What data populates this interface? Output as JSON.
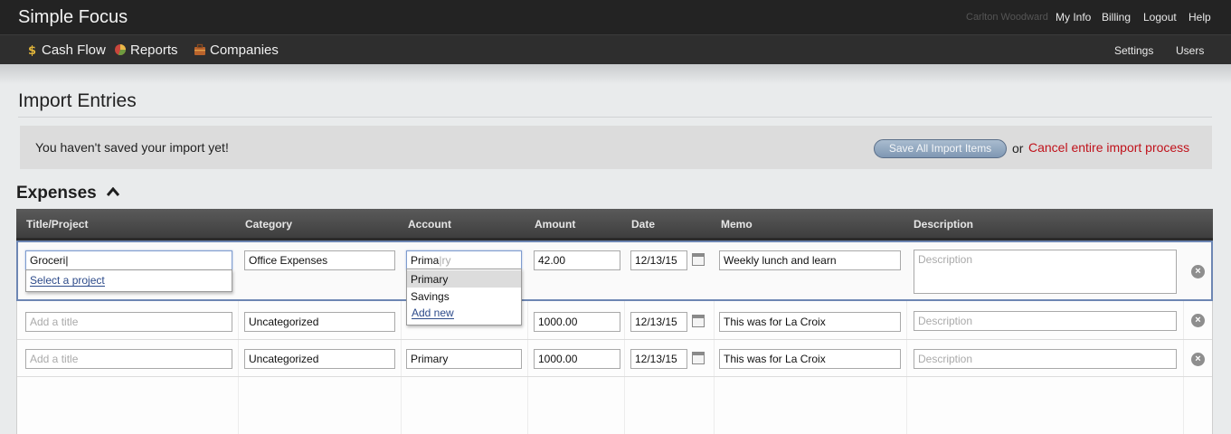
{
  "header": {
    "app_title": "Simple Focus",
    "user_name": "Carlton Woodward",
    "links": [
      "My Info",
      "Billing",
      "Logout",
      "Help"
    ]
  },
  "nav": {
    "items": [
      "Cash Flow",
      "Reports",
      "Companies"
    ],
    "right_links": [
      "Settings",
      "Users"
    ]
  },
  "page": {
    "title": "Import Entries"
  },
  "notice": {
    "message": "You haven't saved your import yet!",
    "save_label": "Save All Import Items",
    "or_text": "or",
    "cancel_label": "Cancel entire import process"
  },
  "section": {
    "title": "Expenses",
    "caret": "⌃"
  },
  "table": {
    "columns": [
      "Title/Project",
      "Category",
      "Account",
      "Amount",
      "Date",
      "Memo",
      "Description"
    ],
    "rows": [
      {
        "title": "Groceri|",
        "category": "Office Expenses",
        "account_typed": "Prima",
        "account_hint": "|ry",
        "amount": "42.00",
        "date": "12/13/15",
        "memo": "Weekly lunch and learn",
        "description_placeholder": "Description"
      },
      {
        "title_placeholder": "Add a title",
        "category": "Uncategorized",
        "account": "Primary",
        "amount": "1000.00",
        "date": "12/13/15",
        "memo": "This was for La Croix",
        "description_placeholder": "Description"
      },
      {
        "title_placeholder": "Add a title",
        "category": "Uncategorized",
        "account": "Primary",
        "amount": "1000.00",
        "date": "12/13/15",
        "memo": "This was for La Croix",
        "description_placeholder": "Description"
      }
    ]
  },
  "project_dropdown": {
    "link": "Select a project"
  },
  "account_dropdown": {
    "options": [
      "Primary",
      "Savings"
    ],
    "highlighted": "Primary",
    "add_new": "Add new"
  },
  "icons": {
    "remove": "×"
  }
}
